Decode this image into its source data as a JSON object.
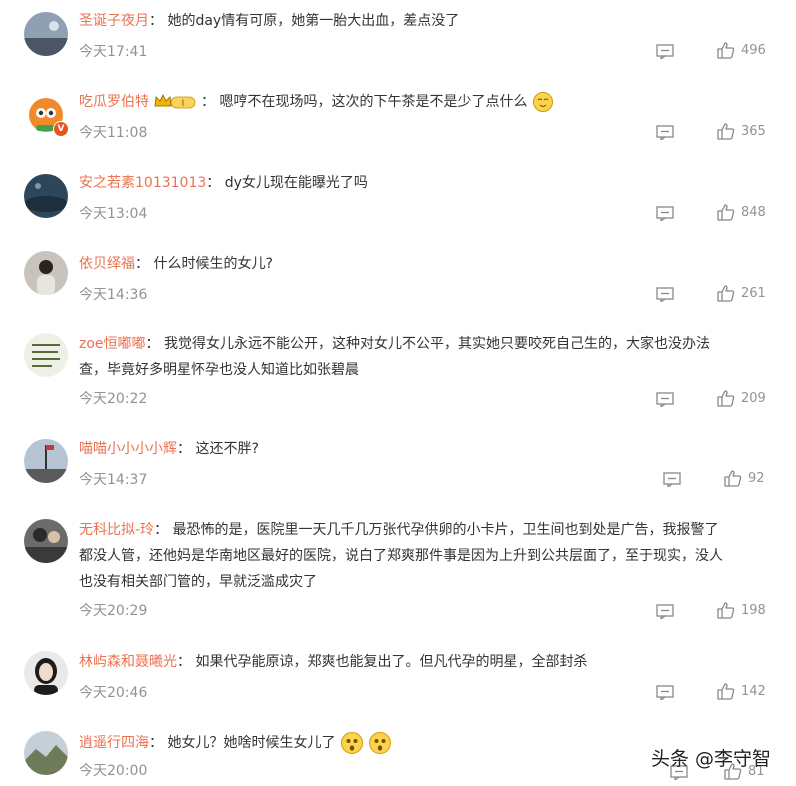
{
  "comments": [
    {
      "user": "圣诞子夜月",
      "text": "她的day情有可原，她第一胎大出血，差点没了",
      "time": "今天17:41",
      "likes": "496"
    },
    {
      "user": "吃瓜罗伯特",
      "text": "嗯哼不在现场吗，这次的下午茶是不是少了点什么",
      "time": "今天11:08",
      "likes": "365",
      "level_badge": "I"
    },
    {
      "user": "安之若素10131013",
      "text": "dy女儿现在能曝光了吗",
      "time": "今天13:04",
      "likes": "848"
    },
    {
      "user": "依贝绎福",
      "text": "什么时候生的女儿?",
      "time": "今天14:36",
      "likes": "261"
    },
    {
      "user": "zoe恒嘟嘟",
      "text": "我觉得女儿永远不能公开，这种对女儿不公平，其实她只要咬死自己生的，大家也没办法",
      "text2": "查，毕竟好多明星怀孕也没人知道比如张碧晨",
      "time": "今天20:22",
      "likes": "209"
    },
    {
      "user": "喵喵小小小小辉",
      "text": "这还不胖?",
      "time": "今天14:37",
      "likes": "92"
    },
    {
      "user": "无科比拟-玲",
      "text": "最恐怖的是，医院里一天几千几万张代孕供卵的小卡片，卫生间也到处是广告，我报警了",
      "text2": "都没人管，还他妈是华南地区最好的医院，说白了郑爽那件事是因为上升到公共层面了，至于现实，没人",
      "text3": "也没有相关部门管的，早就泛滥成灾了",
      "time": "今天20:29",
      "likes": "198"
    },
    {
      "user": "林屿森和聂曦光",
      "text": "如果代孕能原谅，郑爽也能复出了。但凡代孕的明星，全部封杀",
      "time": "今天20:46",
      "likes": "142"
    },
    {
      "user": "逍遥行四海",
      "text": "她女儿？她啥时候生女儿了",
      "time": "今天20:00",
      "likes": "81"
    }
  ],
  "watermark": "头条 @李守智",
  "colors": {
    "username": "#eb7350",
    "meta": "#939393",
    "text": "#333333"
  }
}
